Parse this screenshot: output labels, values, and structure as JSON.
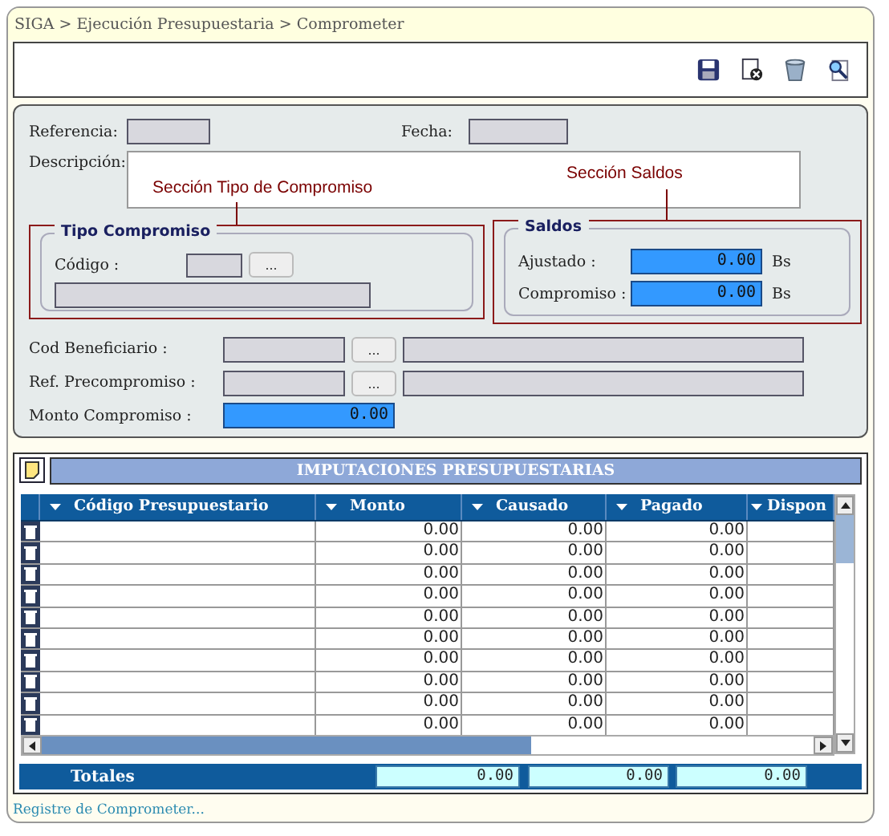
{
  "breadcrumb": "SIGA > Ejecución Presupuestaria > Comprometer",
  "form": {
    "referencia_label": "Referencia:",
    "fecha_label": "Fecha:",
    "descripcion_label": "Descripción:",
    "annotations": [
      {
        "kind": "tipo",
        "text": "Sección Tipo de Compromiso"
      },
      {
        "kind": "saldos",
        "text": "Sección Saldos"
      }
    ],
    "tipo_compromiso": {
      "title": "Tipo Compromiso",
      "codigo_label": "Código :",
      "lookup": "..."
    },
    "saldos": {
      "title": "Saldos",
      "rows": [
        {
          "label": "Ajustado :",
          "value": "0.00",
          "unit": "Bs"
        },
        {
          "label": "Compromiso :",
          "value": "0.00",
          "unit": "Bs"
        }
      ]
    },
    "lookups": [
      {
        "label": "Cod Beneficiario :",
        "button": "..."
      },
      {
        "label": "Ref. Precompromiso :",
        "button": "..."
      }
    ],
    "monto": {
      "label": "Monto Compromiso :",
      "value": "0.00"
    }
  },
  "grid": {
    "title": "IMPUTACIONES PRESUPUESTARIAS",
    "columns": [
      "Código Presupuestario",
      "Monto",
      "Causado",
      "Pagado",
      "Dispon"
    ],
    "rows": [
      {
        "monto": "0.00",
        "causado": "0.00",
        "pagado": "0.00"
      },
      {
        "monto": "0.00",
        "causado": "0.00",
        "pagado": "0.00"
      },
      {
        "monto": "0.00",
        "causado": "0.00",
        "pagado": "0.00"
      },
      {
        "monto": "0.00",
        "causado": "0.00",
        "pagado": "0.00"
      },
      {
        "monto": "0.00",
        "causado": "0.00",
        "pagado": "0.00"
      },
      {
        "monto": "0.00",
        "causado": "0.00",
        "pagado": "0.00"
      },
      {
        "monto": "0.00",
        "causado": "0.00",
        "pagado": "0.00"
      },
      {
        "monto": "0.00",
        "causado": "0.00",
        "pagado": "0.00"
      },
      {
        "monto": "0.00",
        "causado": "0.00",
        "pagado": "0.00"
      },
      {
        "monto": "0.00",
        "causado": "0.00",
        "pagado": "0.00"
      }
    ],
    "totals": {
      "label": "Totales",
      "values": [
        "0.00",
        "0.00",
        "0.00"
      ]
    }
  },
  "status": "Registre de Comprometer..."
}
